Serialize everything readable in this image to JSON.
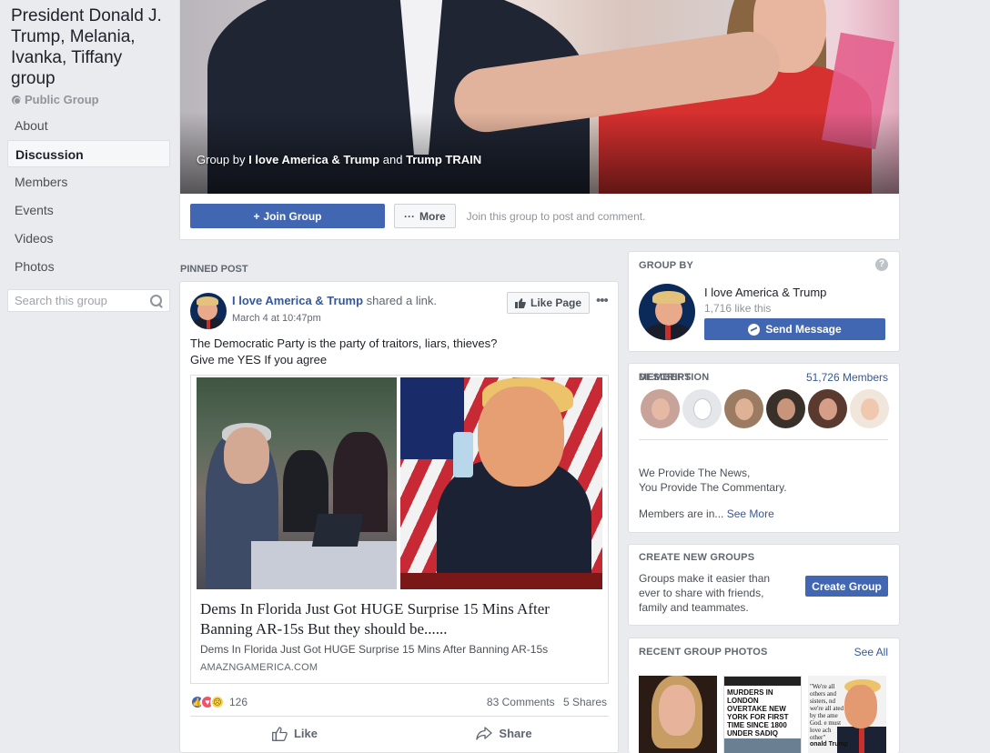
{
  "group": {
    "title": "President Donald J. Trump, Melania, Ivanka, Tiffany group",
    "type": "Public Group"
  },
  "nav": {
    "items": [
      {
        "label": "About"
      },
      {
        "label": "Discussion"
      },
      {
        "label": "Members"
      },
      {
        "label": "Events"
      },
      {
        "label": "Videos"
      },
      {
        "label": "Photos"
      }
    ],
    "search_placeholder": "Search this group"
  },
  "cover": {
    "caption_prefix": "Group by",
    "owner1": "I love America & Trump",
    "and": "and",
    "owner2": "Trump TRAIN"
  },
  "actions": {
    "join_label": "Join Group",
    "more_label": "More",
    "join_note": "Join this group to post and comment."
  },
  "pinned_label": "PINNED POST",
  "post": {
    "author": "I love America & Trump",
    "action": "shared a link.",
    "time": "March 4 at 10:47pm",
    "like_page_label": "Like Page",
    "text_line1": "The Democratic Party is the party of traitors, liars, thieves?",
    "text_line2": "Give me YES If you agree",
    "link": {
      "title": "Dems In Florida Just Got HUGE Surprise 15 Mins After Banning AR-15s But they should be......",
      "subtitle": "Dems In Florida Just Got HUGE Surprise 15 Mins After Banning AR-15s",
      "domain": "AMAZNGAMERICA.COM"
    },
    "reaction_count": "126",
    "comments": "83 Comments",
    "shares": "5 Shares",
    "like_label": "Like",
    "share_label": "Share"
  },
  "group_by": {
    "header": "GROUP BY",
    "name": "I love America & Trump",
    "likes": "1,716 like this",
    "send_label": "Send Message"
  },
  "members": {
    "header": "MEMBERS",
    "count": "51,726 Members",
    "description_header": "DESCRIPTION",
    "description_line1": "We Provide The News,",
    "description_line2": "You Provide The Commentary.",
    "members_are_in": "Members are in...",
    "see_more": "See More",
    "avatar_colors": [
      "#c7a39a",
      "#d8dadf",
      "#b5876a",
      "#5a4a3e",
      "#8a5a4a",
      "#efe0d6"
    ]
  },
  "create": {
    "header": "CREATE NEW GROUPS",
    "text": "Groups make it easier than ever to share with friends, family and teammates.",
    "button_label": "Create Group"
  },
  "photos": {
    "header": "RECENT GROUP PHOTOS",
    "see_all": "See All",
    "photo2_text": "MURDERS IN LONDON OVERTAKE NEW YORK FOR FIRST TIME SINCE 1800 UNDER SADIQ KHAN",
    "photo3_text": "\"We're all others and sisters, nd we're all ated by the ame God. e must love ach other\"",
    "photo3_caption": "onald Trump"
  }
}
